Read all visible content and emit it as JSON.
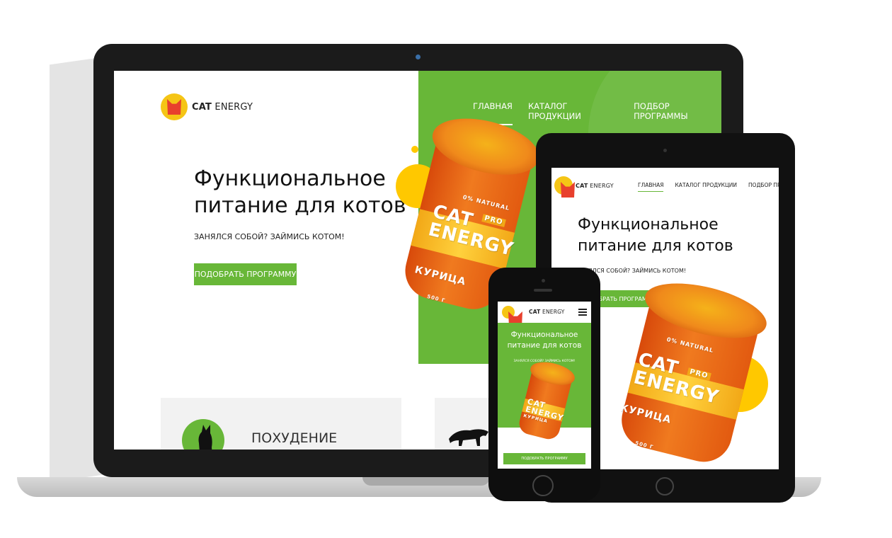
{
  "brand": {
    "name_bold": "CAT",
    "name_light": "ENERGY",
    "accent_color": "#68b738",
    "yellow_color": "#ffc800",
    "orange_color": "#f07a1f"
  },
  "nav": {
    "items": [
      {
        "label": "ГЛАВНАЯ",
        "active": true
      },
      {
        "label": "КАТАЛОГ ПРОДУКЦИИ",
        "active": false
      },
      {
        "label": "ПОДБОР ПРОГРАММЫ",
        "active": false
      }
    ]
  },
  "hero": {
    "title_line1": "Функциональное",
    "title_line2": "питание для котов",
    "subtitle": "ЗАНЯЛСЯ СОБОЙ? ЗАЙМИСЬ КОТОМ!",
    "tablet_subtitle": "НЯЛСЯ СОБОЙ? ЗАЙМИСЬ КОТОМ!",
    "cta_label": "ПОДОБРАТЬ ПРОГРАММУ",
    "tablet_cta_label": "ОБРАТЬ ПРОГРАММУ"
  },
  "product": {
    "brand_line1": "CAT",
    "brand_line2": "ENERGY",
    "pro_label": "PRO",
    "natural_label": "0% NATURAL",
    "flavor": "КУРИЦА",
    "weight": "500 Г"
  },
  "features": {
    "card1_title": "ПОХУДЕНИЕ"
  },
  "phone": {
    "menu_icon": "burger-icon"
  }
}
